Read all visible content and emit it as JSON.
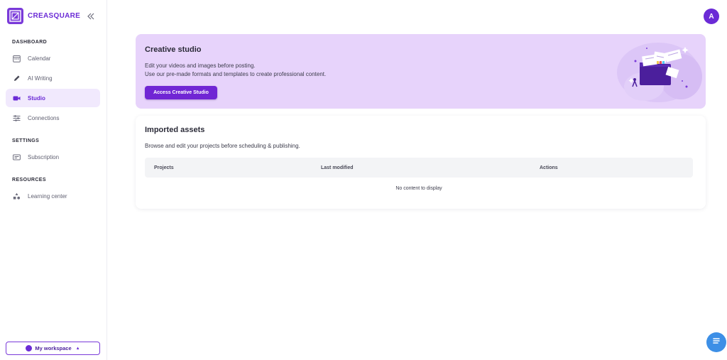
{
  "brand": {
    "name": "CREASQUARE",
    "color": "#6b2bd6"
  },
  "sidebar": {
    "sections": [
      {
        "title": "DASHBOARD"
      },
      {
        "title": "SETTINGS"
      },
      {
        "title": "RESOURCES"
      }
    ],
    "items": [
      {
        "label": "Calendar",
        "icon": "calendar-icon"
      },
      {
        "label": "AI Writing",
        "icon": "pen-icon"
      },
      {
        "label": "Studio",
        "icon": "video-camera-icon",
        "active": true
      },
      {
        "label": "Connections",
        "icon": "sliders-icon"
      },
      {
        "label": "Subscription",
        "icon": "subscription-icon"
      },
      {
        "label": "Learning center",
        "icon": "shapes-icon"
      }
    ],
    "workspace_label": "My workspace"
  },
  "user": {
    "avatar_initial": "A"
  },
  "banner": {
    "title": "Creative studio",
    "line1": "Edit your videos and images before posting.",
    "line2": "Use our pre-made formats and templates to create professional content.",
    "button_label": "Access Creative Studio"
  },
  "assets": {
    "title": "Imported assets",
    "subtitle": "Browse and edit your projects before scheduling & publishing.",
    "columns": [
      "Projects",
      "Last modified",
      "Actions"
    ],
    "empty_text": "No content to display"
  },
  "colors": {
    "accent": "#7026d4",
    "banner_bg": "#e7d3fb",
    "active_bg": "#f1e9fd",
    "chat": "#3d8fe6"
  }
}
